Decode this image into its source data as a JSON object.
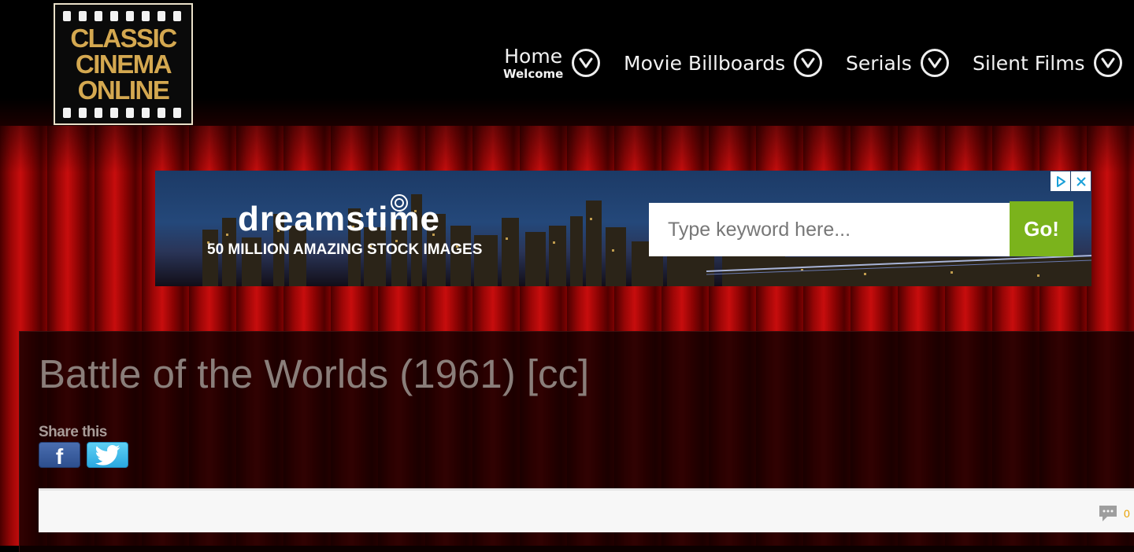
{
  "logo": {
    "lines": [
      "Classic",
      "Cinema",
      "Online"
    ]
  },
  "nav": {
    "items": [
      {
        "label": "Home",
        "sub": "Welcome"
      },
      {
        "label": "Movie Billboards"
      },
      {
        "label": "Serials"
      },
      {
        "label": "Silent Films"
      }
    ]
  },
  "ad": {
    "brand": "dreamstime",
    "tagline": "50 MILLION AMAZING STOCK IMAGES",
    "search_placeholder": "Type keyword here...",
    "go_label": "Go!"
  },
  "content": {
    "title": "Battle of the Worlds (1961) [cc]",
    "share_label": "Share this",
    "facebook_glyph": "f",
    "comment_count": "0"
  },
  "colors": {
    "logo_gold": "#d4a850",
    "go_green": "#7bb31c",
    "curtain_red": "#c70d0d",
    "facebook_blue": "#3b5998",
    "twitter_blue": "#2aa9e0"
  }
}
